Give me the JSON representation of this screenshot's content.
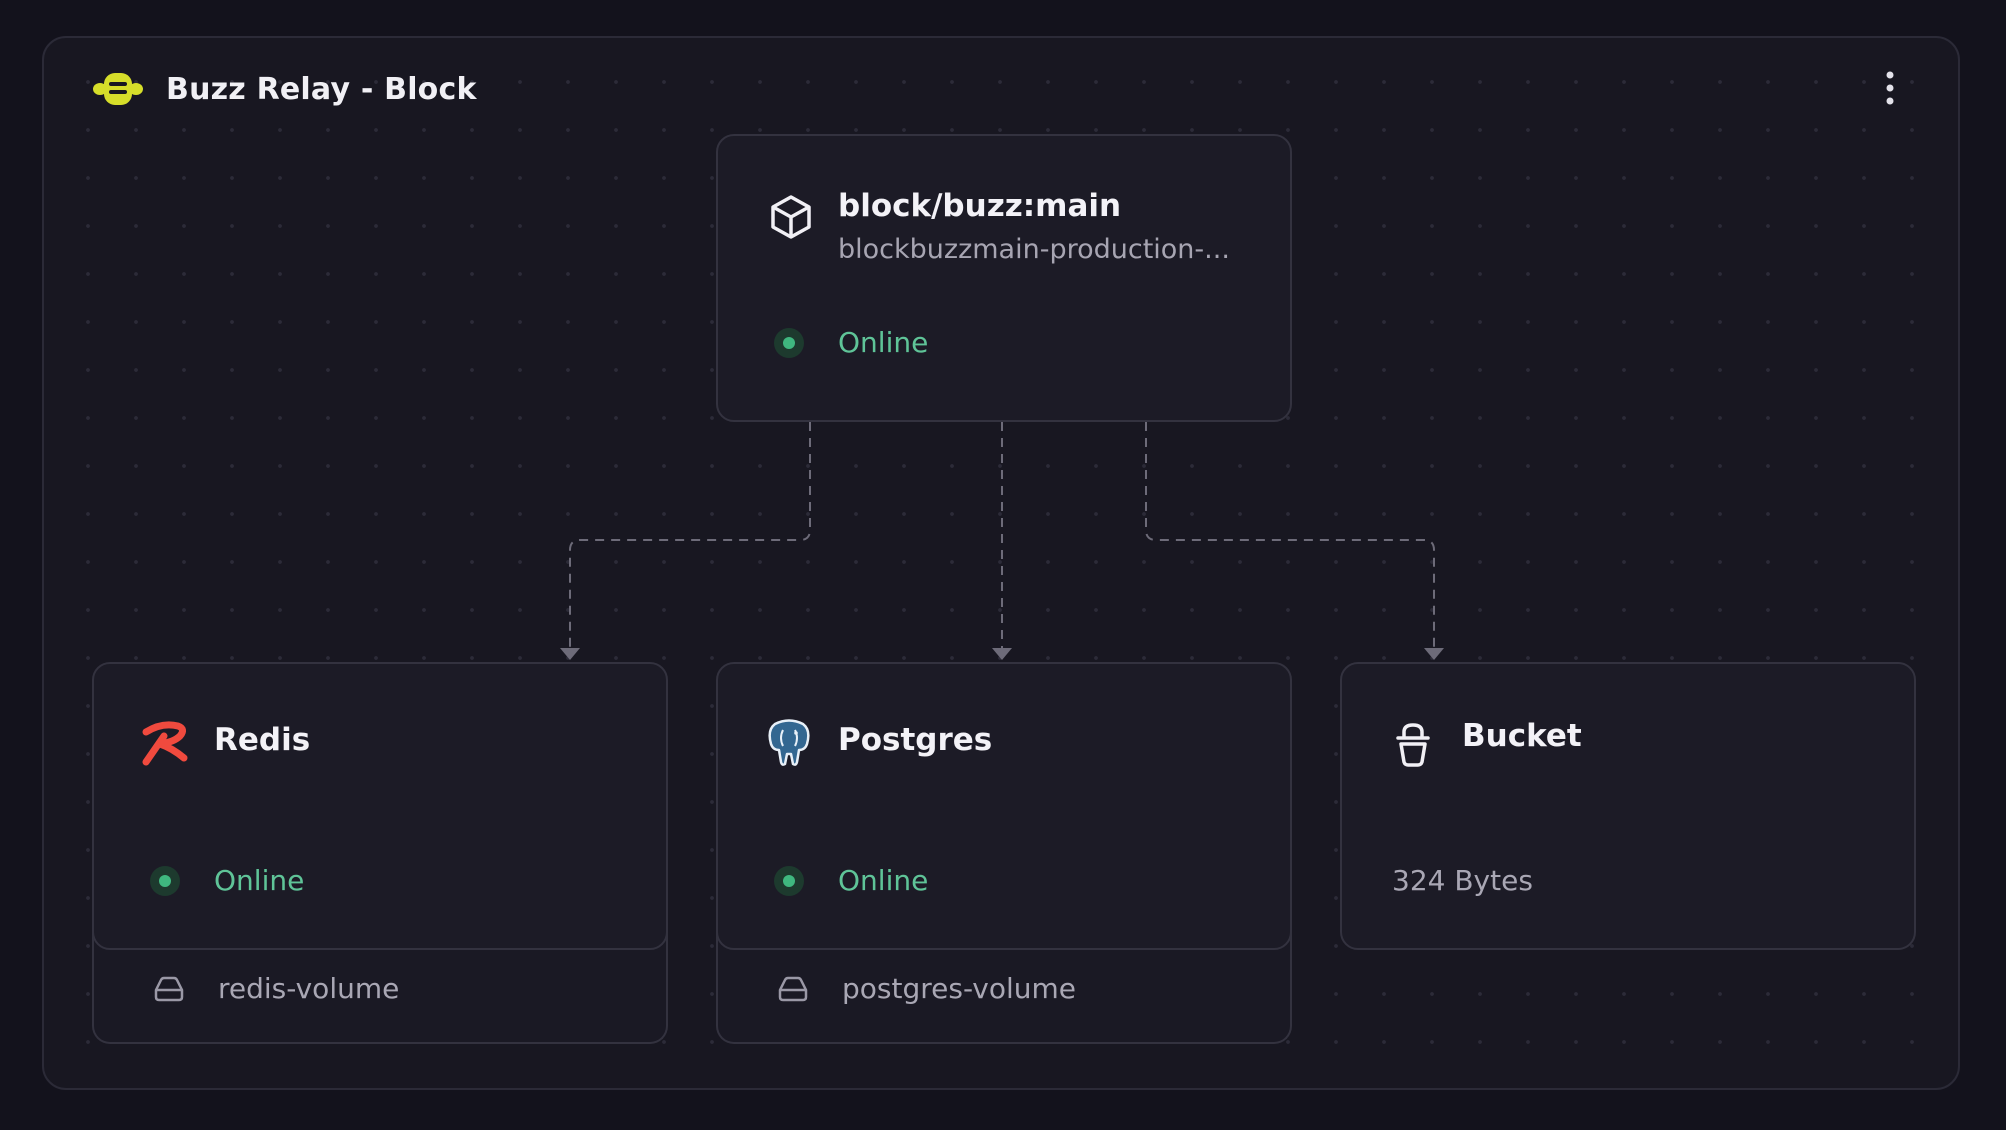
{
  "project": {
    "title": "Buzz Relay - Block",
    "logo_icon": "bee-icon",
    "menu_icon": "vertical-dots-icon"
  },
  "colors": {
    "background": "#13121c",
    "canvas": "#181721",
    "card": "#1c1b26",
    "border": "#33323f",
    "online": "#5fc498",
    "logo": "#d6de2a",
    "redis": "#f04a3e",
    "postgres": "#336791"
  },
  "services": {
    "main": {
      "title": "block/buzz:main",
      "subtitle": "blockbuzzmain-production-...",
      "status": "Online",
      "icon": "cube-icon"
    },
    "redis": {
      "title": "Redis",
      "status": "Online",
      "icon": "redis-icon",
      "volume": "redis-volume",
      "volume_icon": "drive-icon"
    },
    "postgres": {
      "title": "Postgres",
      "status": "Online",
      "icon": "postgres-elephant-icon",
      "volume": "postgres-volume",
      "volume_icon": "drive-icon"
    },
    "bucket": {
      "title": "Bucket",
      "size": "324 Bytes",
      "icon": "bucket-icon"
    }
  }
}
